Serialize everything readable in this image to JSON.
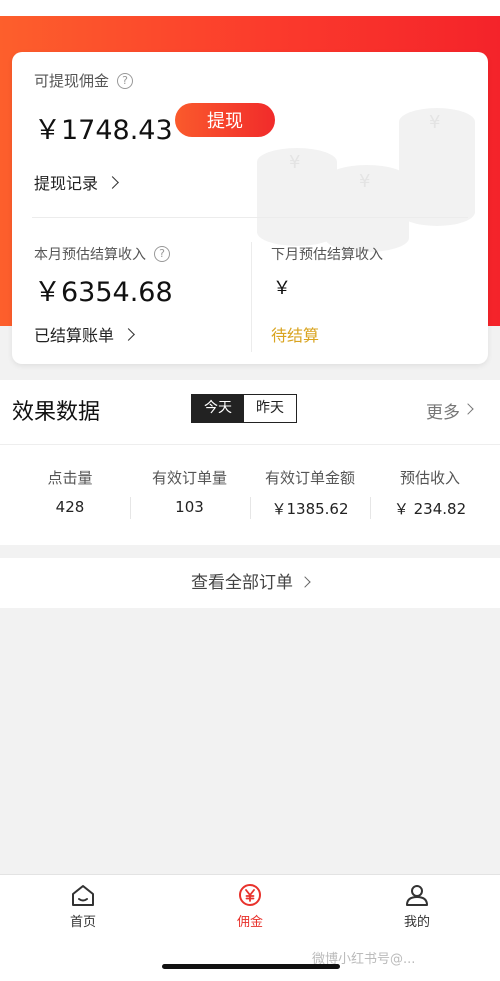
{
  "theme": {
    "accent": "#f4232a",
    "pending_color": "#d9a420"
  },
  "balance": {
    "withdrawable_label": "可提现佣金",
    "amount": "￥1748.43",
    "withdraw_button": "提现",
    "record_link": "提现记录"
  },
  "estimate": {
    "this_month_label": "本月预估结算收入",
    "this_month_amount": "￥6354.68",
    "settled_bill_link": "已结算账单",
    "next_month_label": "下月预估结算收入",
    "next_month_amount": "￥",
    "pending_label": "待结算"
  },
  "effect": {
    "title": "效果数据",
    "toggle": [
      "今天",
      "昨天"
    ],
    "active_toggle": "今天",
    "more_link": "更多"
  },
  "stats": [
    {
      "label": "点击量",
      "value": "428"
    },
    {
      "label": "有效订单量",
      "value": "103"
    },
    {
      "label": "有效订单金额",
      "value": "￥1385.62"
    },
    {
      "label": "预估收入",
      "value": "￥ 234.82"
    }
  ],
  "view_all_orders": "查看全部订单",
  "tabbar": {
    "items": [
      {
        "label": "首页",
        "icon": "home-icon",
        "active": false
      },
      {
        "label": "佣金",
        "icon": "commission-yen-icon",
        "active": true
      },
      {
        "label": "我的",
        "icon": "user-icon",
        "active": false
      }
    ]
  },
  "watermark": "微博小红书号@..."
}
